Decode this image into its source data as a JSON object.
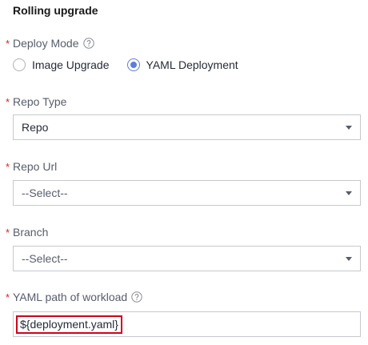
{
  "section": {
    "title": "Rolling upgrade"
  },
  "required_mark": "*",
  "deploy_mode": {
    "label": "Deploy Mode",
    "options": [
      {
        "label": "Image Upgrade",
        "checked": false
      },
      {
        "label": "YAML Deployment",
        "checked": true
      }
    ]
  },
  "repo_type": {
    "label": "Repo Type",
    "value": "Repo"
  },
  "repo_url": {
    "label": "Repo Url",
    "value": "--Select--"
  },
  "branch": {
    "label": "Branch",
    "value": "--Select--"
  },
  "yaml_path": {
    "label": "YAML path of workload",
    "value": "${deployment.yaml}"
  },
  "colors": {
    "accent": "#5e7ce0",
    "required": "#e02020",
    "highlight_border": "#d0021b"
  },
  "icons": {
    "help": "question-circle-icon",
    "dropdown": "caret-down-icon"
  }
}
